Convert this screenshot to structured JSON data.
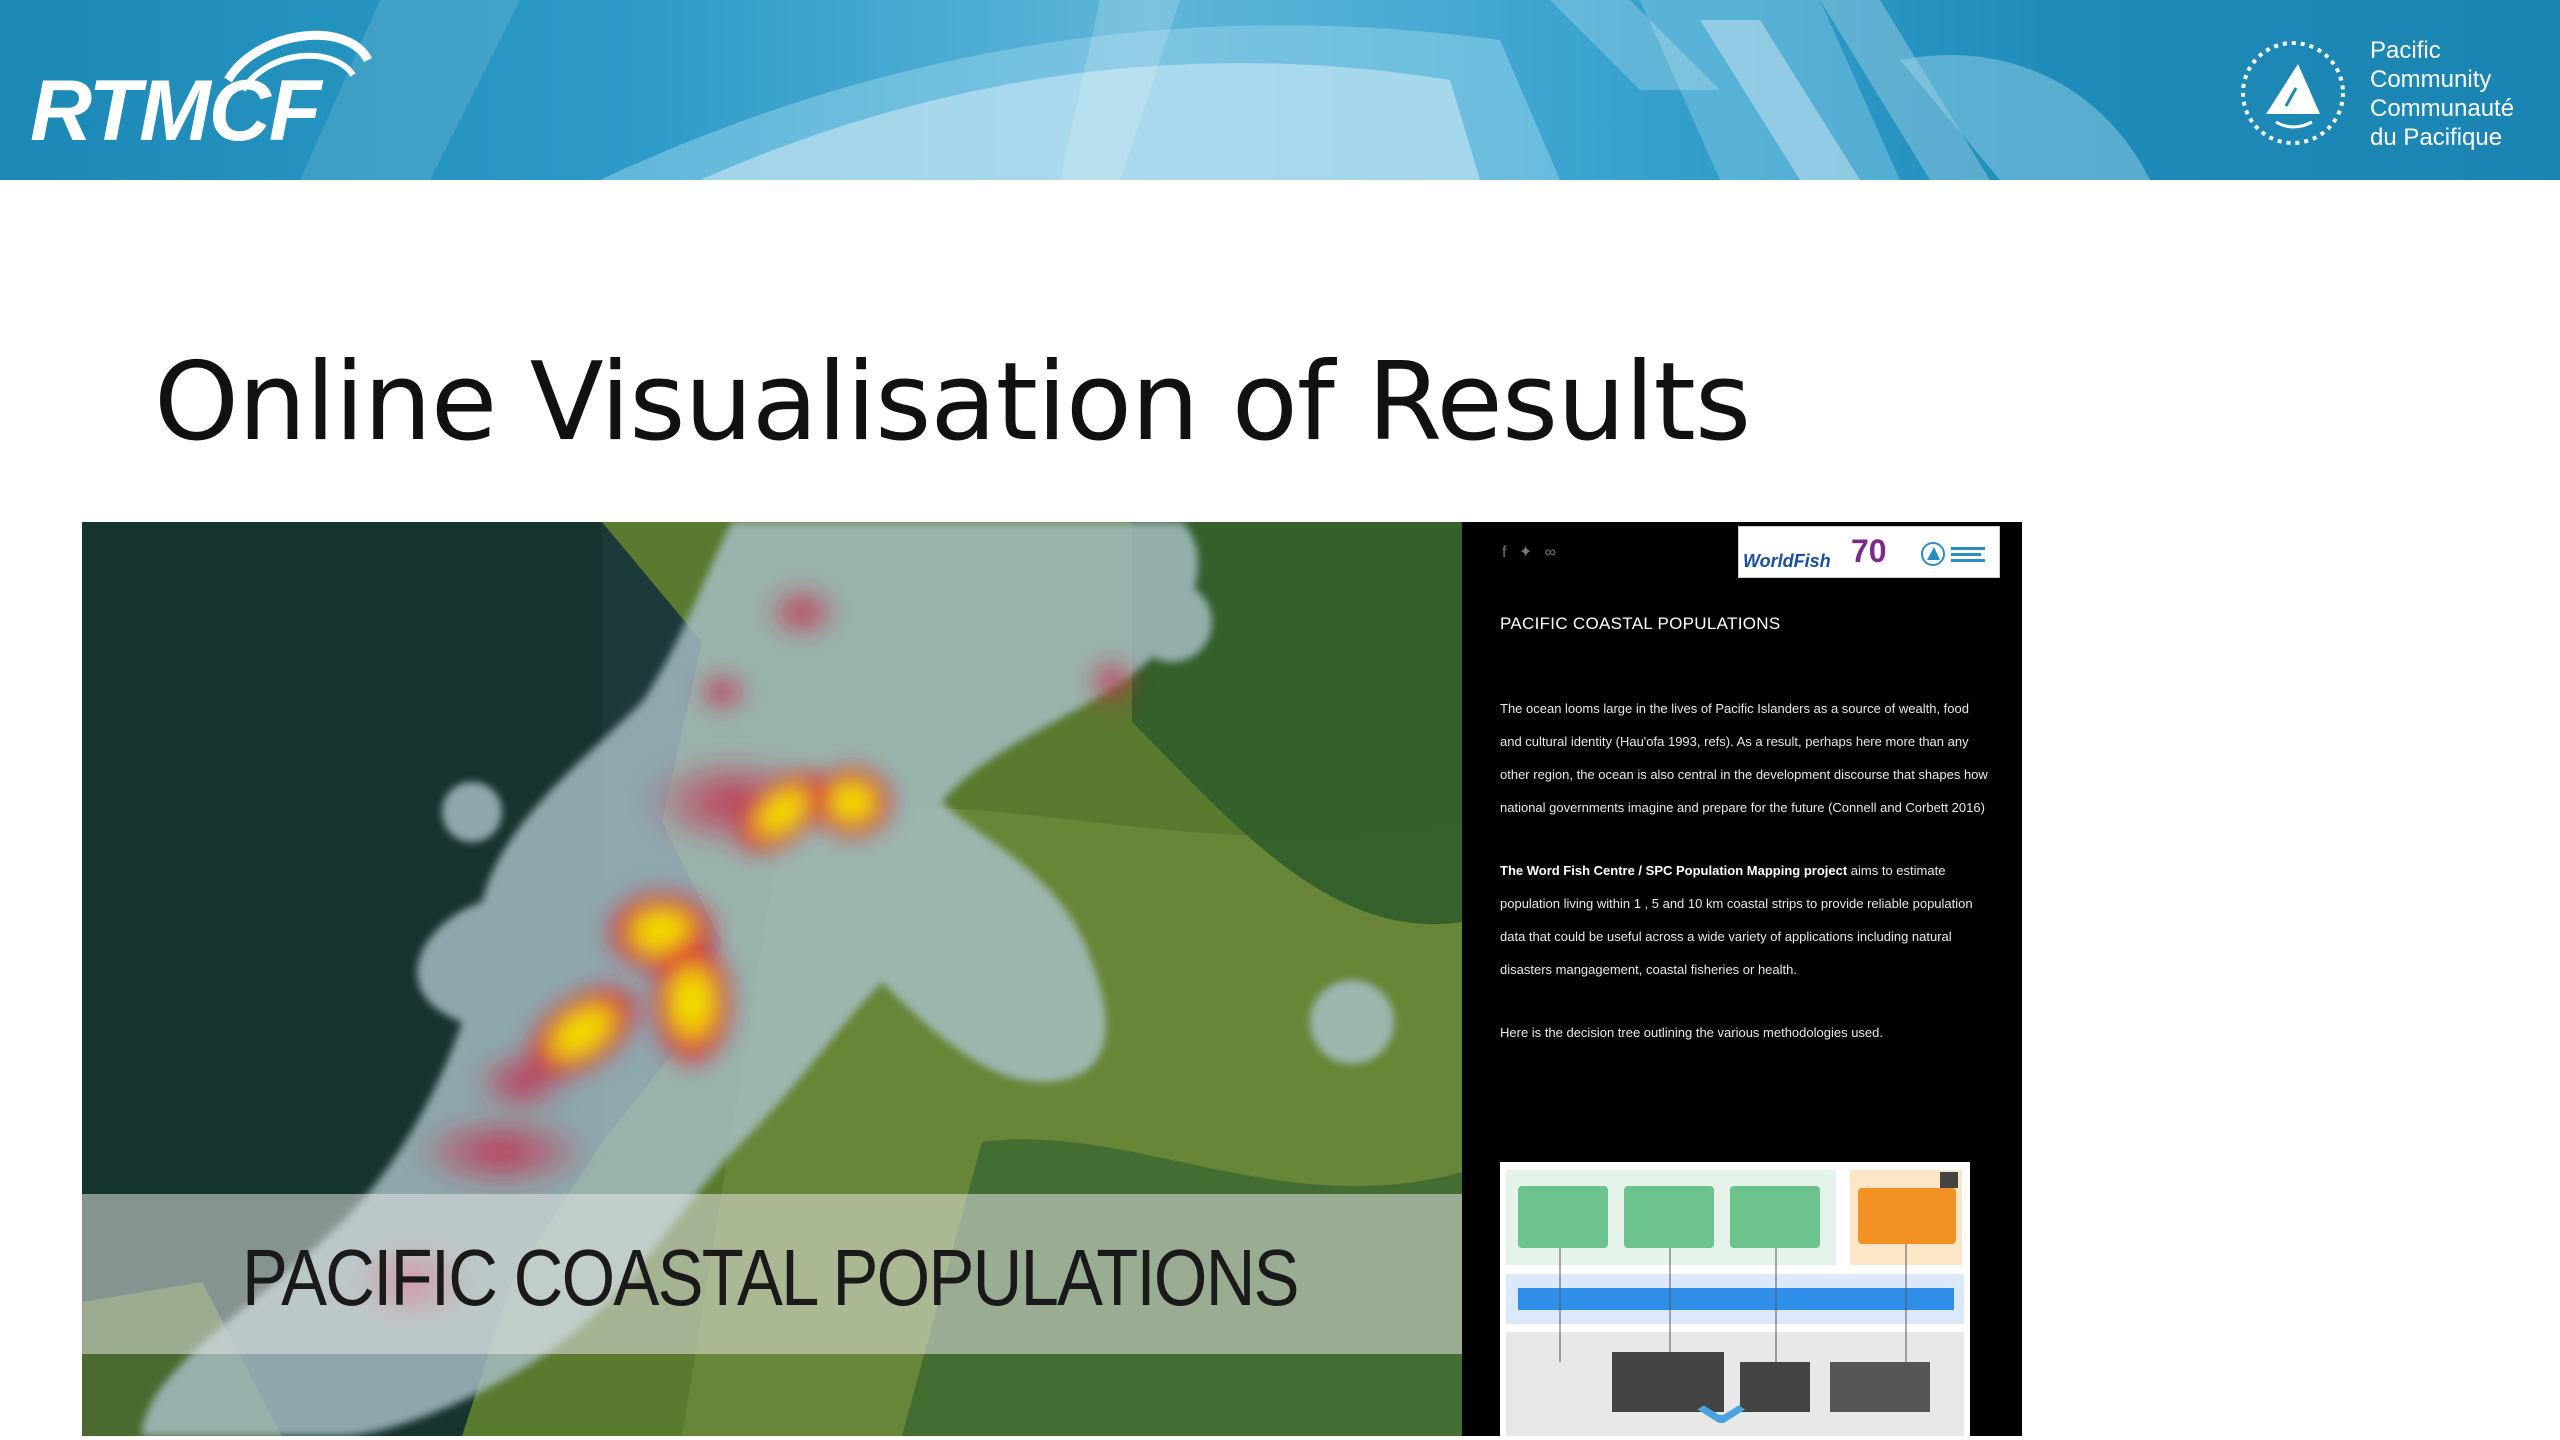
{
  "banner": {
    "logo_left": "RTMCF",
    "logo_right_lines": [
      "Pacific",
      "Community",
      "Communauté",
      "du Pacifique"
    ]
  },
  "slide": {
    "title": "Online Visualisation of Results"
  },
  "screenshot": {
    "map_caption": "PACIFIC COASTAL POPULATIONS",
    "share_icons": [
      "facebook-icon",
      "twitter-icon",
      "link-icon"
    ],
    "partner_logo_text": "WorldFish",
    "partner_logo_number": "70",
    "panel_title": "PACIFIC COASTAL POPULATIONS",
    "paragraph1": "The ocean looms large in the lives of Pacific Islanders as a source of wealth, food and cultural identity (Hau'ofa 1993, refs). As a result, perhaps here more than any other region, the ocean is also central in the development discourse that shapes how national governments imagine and prepare for the future (Connell and Corbett 2016)",
    "paragraph2_bold": "The Word Fish Centre / SPC Population Mapping project",
    "paragraph2_rest": " aims to estimate population living within 1 , 5 and 10 km coastal strips to provide reliable population data that could be useful across a wide variety of applications including natural disasters mangagement, coastal fisheries or health.",
    "paragraph3": "Here is the decision tree outlining the various methodologies used.",
    "colors": {
      "banner_blue": "#1c88b5",
      "heat_yellow": "#f4f000",
      "heat_red": "#d8203a",
      "buffer_gray": "#a8c0c8",
      "tree_orange": "#f39224",
      "tree_blue": "#2f8fe8",
      "tree_green": "#6cc38e"
    }
  }
}
